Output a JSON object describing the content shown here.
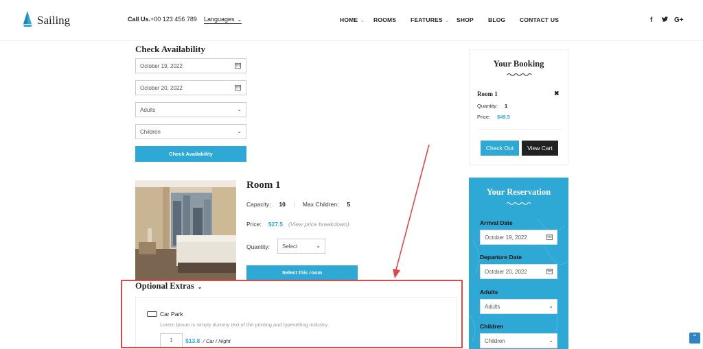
{
  "header": {
    "logo_text": "Sailing",
    "call_label": "Call Us.",
    "call_number": "+00 123 456 789",
    "languages": "Languages",
    "nav": [
      {
        "label": "HOME",
        "has_caret": true
      },
      {
        "label": "ROOMS",
        "has_caret": false
      },
      {
        "label": "FEATURES",
        "has_caret": true
      },
      {
        "label": "SHOP",
        "has_caret": false
      },
      {
        "label": "BLOG",
        "has_caret": false
      },
      {
        "label": "CONTACT US",
        "has_caret": false
      }
    ],
    "social": [
      "f",
      "t",
      "G+"
    ]
  },
  "availability": {
    "title": "Check Availability",
    "check_in": "October 19, 2022",
    "check_out": "October 20, 2022",
    "adults": "Adults",
    "children": "Children",
    "button": "Check Availability"
  },
  "room": {
    "title": "Room 1",
    "capacity_label": "Capacity:",
    "capacity": "10",
    "max_children_label": "Max Children:",
    "max_children": "5",
    "price_label": "Price:",
    "price": "$27.5",
    "price_breakdown": "(View price breakdown)",
    "quantity_label": "Quantity:",
    "quantity_select": "Select",
    "select_button": "Select this room"
  },
  "extras": {
    "title": "Optional Extras",
    "item_label": "Car Park",
    "item_desc": "Lorem Ipsum is simply dummy text of the printing and typesetting industry",
    "item_qty": "1",
    "item_price": "$13.8",
    "item_unit": "/ Car / Night"
  },
  "booking": {
    "title": "Your Booking",
    "room": "Room 1",
    "quantity_label": "Quantity:",
    "quantity": "1",
    "price_label": "Price:",
    "price": "$49.5",
    "checkout": "Check Out",
    "view_cart": "View Cart"
  },
  "reservation": {
    "title": "Your Reservation",
    "arrival_label": "Arrival Date",
    "arrival": "October 19, 2022",
    "departure_label": "Departure Date",
    "departure": "October 20, 2022",
    "adults_label": "Adults",
    "adults": "Adults",
    "children_label": "Children",
    "children": "Children"
  },
  "colors": {
    "accent": "#2ea8d4",
    "highlight_box": "#e04848",
    "dark_button": "#222222"
  },
  "icons": [
    "sailboat-logo-icon",
    "chevron-down-icon",
    "calendar-icon",
    "close-icon",
    "facebook-icon",
    "twitter-icon",
    "google-plus-icon",
    "arrow-up-icon"
  ]
}
